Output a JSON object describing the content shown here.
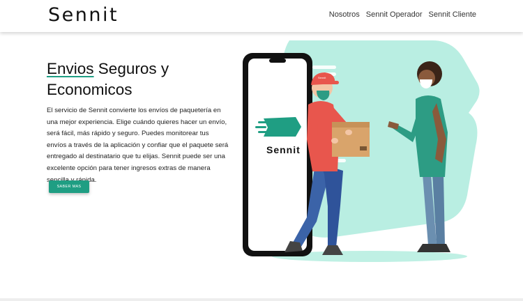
{
  "navbar": {
    "logo": "Sennit",
    "links": [
      "Nosotros",
      "Sennit Operador",
      "Sennit Cliente"
    ]
  },
  "hero": {
    "title_accent": "Envios",
    "title_rest": " Seguros y Economicos",
    "description": "El servicio de Sennit convierte los envíos de paquetería en una mejor experiencia. Elige cuándo quieres hacer un envío, será fácil, más rápido y seguro. Puedes monitorear tus envíos a través de la aplicación y confiar que el paquete será entregado al destinatario que tu elijas. Sennit puede ser una excelente opción para tener ingresos extras de manera sencilla y rápida.",
    "cta_label": "SABER MAS"
  },
  "illustration": {
    "phone_logo": "Sennit",
    "cap_label": "Sennit"
  },
  "colors": {
    "accent": "#1f9e83",
    "mint": "#b9eee2",
    "shirt_red": "#e8564d",
    "jeans": "#3b63a8",
    "box": "#d9a46b",
    "woman_top": "#2d9c84"
  }
}
